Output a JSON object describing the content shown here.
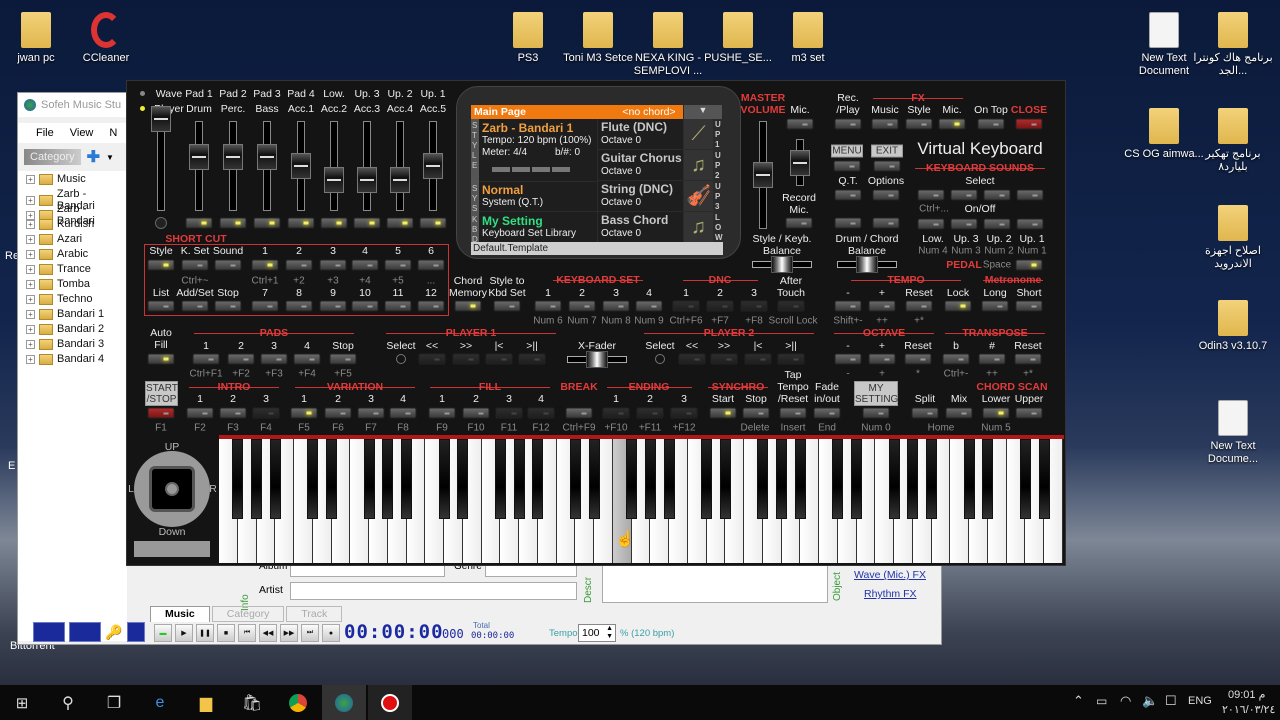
{
  "desktop": {
    "icons_left": [
      "jwan pc",
      "CCleaner"
    ],
    "icons_top": [
      "PS3",
      "Toni M3 Setce",
      "NEXA KING - SEMPLOVI ...",
      "PUSHE_SE...",
      "m3 set"
    ],
    "icons_right": [
      "New Text Document",
      "برنامج هاك كونترا الجد...",
      "CS OG aimwa...",
      "برنامج تهكير بليارد٨",
      "اصلاح اجهزة الاندرويد",
      "Odin3 v3.10.7",
      "New Text Docume..."
    ],
    "partial_left": [
      "Re",
      "E",
      "Bittorrent"
    ]
  },
  "sofeh": {
    "title": "Sofeh Music Stu",
    "menu": [
      "File",
      "View",
      "N"
    ],
    "category_tab": "Category",
    "tree": [
      "Music",
      "Zarb - Bandari",
      "Zarb - Bandari",
      "Kurdish",
      "Azari",
      "Arabic",
      "Trance",
      "Tomba",
      "Techno",
      "Bandari 1",
      "Bandari 2",
      "Bandari 3",
      "Bandari 4"
    ],
    "fields": {
      "album": "Album",
      "genre": "Genre",
      "artist": "Artist",
      "info": "Info",
      "descr": "Descr",
      "object": "Object"
    },
    "links": [
      "Wave (Mic.) FX",
      "Rhythm FX"
    ],
    "tabs": [
      "Music",
      "Category",
      "Track"
    ],
    "time": "00:00:00",
    "ms": "000",
    "total_label": "Total",
    "total": "00:00:00",
    "tempo_label": "Tempo",
    "tempo_value": "100",
    "tempo_unit": "% (120 bpm)"
  },
  "vk": {
    "mixer": {
      "top": [
        "Wave",
        "Pad 1",
        "Pad 2",
        "Pad 3",
        "Pad 4",
        "Low.",
        "Up. 3",
        "Up. 2",
        "Up. 1"
      ],
      "bottom": [
        "Player",
        "Drum",
        "Perc.",
        "Bass",
        "Acc.1",
        "Acc.2",
        "Acc.3",
        "Acc.4",
        "Acc.5"
      ],
      "levels": [
        1.0,
        0.6,
        0.6,
        0.6,
        0.5,
        0.35,
        0.35,
        0.35,
        0.5
      ],
      "leds_on": [
        false,
        true,
        true,
        true,
        true,
        true,
        true,
        true,
        true
      ]
    },
    "shortcut": {
      "title": "SHORT CUT",
      "row1": [
        "Style",
        "K. Set",
        "Sound",
        "1",
        "2",
        "3",
        "4",
        "5",
        "6"
      ],
      "row1_on": [
        true,
        false,
        false,
        true,
        false,
        false,
        false,
        false,
        false
      ],
      "hints": [
        "",
        "Ctrl+~",
        "",
        "Ctrl+1",
        "+2",
        "+3",
        "+4",
        "+5",
        "..."
      ],
      "row2": [
        "List",
        "Add/Set",
        "Stop",
        "7",
        "8",
        "9",
        "10",
        "11",
        "12"
      ]
    },
    "screen": {
      "header": "Main Page",
      "chord": "<no chord>",
      "style_name": "Zarb - Bandari 1",
      "tempo": "Tempo: 120 bpm (100%)",
      "meter": "Meter: 4/4",
      "key": "b/#:  0",
      "sys_name": "Normal",
      "sys_sub": "System (Q.T.)",
      "kbd_name": "My Setting",
      "kbd_sub": "Keyboard Set Library",
      "sounds": [
        {
          "name": "Flute (DNC)",
          "octave": "Octave 0",
          "tag": "UP1"
        },
        {
          "name": "Guitar Chorus",
          "octave": "Octave 0",
          "tag": "UP2"
        },
        {
          "name": "String (DNC)",
          "octave": "Octave 0",
          "tag": "UP3"
        },
        {
          "name": "Bass Chord",
          "octave": "Octave 0",
          "tag": "LOW"
        }
      ],
      "side": [
        "STYLE",
        "SYS",
        "KBD"
      ],
      "footer": "Default.Template"
    },
    "chord_memory": [
      "Chord",
      "Memory"
    ],
    "style_to_kbd": [
      "Style to",
      "Kbd Set"
    ],
    "keyboard_set": {
      "title": "KEYBOARD SET",
      "items": [
        "1",
        "2",
        "3",
        "4"
      ],
      "hints": [
        "Num 6",
        "Num 7",
        "Num 8",
        "Num 9"
      ]
    },
    "dnc": {
      "title": "DNC",
      "items": [
        "1",
        "2",
        "3"
      ],
      "hints": [
        "Ctrl+F6",
        "+F7",
        "+F8"
      ]
    },
    "after_touch": [
      "After",
      "Touch"
    ],
    "scroll_lock": "Scroll Lock",
    "master_volume": [
      "MASTER",
      "VOLUME"
    ],
    "master_level": 0.5,
    "mic": "Mic.",
    "mic_level": 0.5,
    "record_mic": [
      "Record",
      "Mic."
    ],
    "rec_play": [
      "Rec.",
      "/Play"
    ],
    "fx": {
      "title": "FX",
      "items": [
        "Music",
        "Style",
        "Mic."
      ]
    },
    "on_top": "On Top",
    "close": "CLOSE",
    "menu": "MENU",
    "exit": "EXIT",
    "qt": "Q.T.",
    "options": "Options",
    "title": "Virtual Keyboard",
    "keyboard_sounds": {
      "title": "KEYBOARD SOUNDS",
      "select": "Select",
      "ctrl": "Ctrl+...",
      "onoff": "On/Off",
      "items": [
        "Low.",
        "Up. 3",
        "Up. 2",
        "Up. 1"
      ],
      "hints": [
        "Num 4",
        "Num 3",
        "Num 2",
        "Num 1"
      ]
    },
    "pedal": "PEDAL",
    "space": "Space",
    "style_balance": [
      "Style / Keyb.",
      "Balance"
    ],
    "drum_balance": [
      "Drum / Chord",
      "Balance"
    ],
    "balance_levels": [
      0.5,
      0.5
    ],
    "tempo": {
      "title": "TEMPO",
      "items": [
        "-",
        "+",
        "Reset",
        "Lock"
      ],
      "hints": [
        "Shift+-",
        "++",
        "+*"
      ]
    },
    "metronome": {
      "title": "Metronome",
      "items": [
        "Long",
        "Short"
      ]
    },
    "auto_fill": [
      "Auto",
      "Fill"
    ],
    "pads": {
      "title": "PADS",
      "items": [
        "1",
        "2",
        "3",
        "4",
        "Stop"
      ],
      "hints": [
        "Ctrl+F1",
        "+F2",
        "+F3",
        "+F4",
        "+F5"
      ]
    },
    "player1": {
      "title": "PLAYER 1",
      "items": [
        "Select",
        "<<",
        ">>",
        "|<",
        ">||"
      ]
    },
    "xfader": "X-Fader",
    "xfader_level": 0.5,
    "player2": {
      "title": "PLAYER 2",
      "items": [
        "Select",
        "<<",
        ">>",
        "|<",
        ">||"
      ]
    },
    "octave": {
      "title": "OCTAVE",
      "items": [
        "-",
        "+",
        "Reset"
      ],
      "hints": [
        "-",
        "+",
        "*"
      ]
    },
    "transpose": {
      "title": "TRANSPOSE",
      "items": [
        "b",
        "#",
        "Reset"
      ],
      "hints": [
        "Ctrl+-",
        "++",
        "+*"
      ]
    },
    "start_stop": [
      "START",
      "/STOP"
    ],
    "intro": {
      "title": "INTRO",
      "items": [
        "1",
        "2",
        "3"
      ]
    },
    "variation": {
      "title": "VARIATION",
      "items": [
        "1",
        "2",
        "3",
        "4"
      ]
    },
    "fill": {
      "title": "FILL",
      "items": [
        "1",
        "2",
        "3",
        "4"
      ]
    },
    "break": "BREAK",
    "ending": {
      "title": "ENDING",
      "items": [
        "1",
        "2",
        "3"
      ]
    },
    "synchro": {
      "title": "SYNCHRO",
      "items": [
        "Start",
        "Stop"
      ]
    },
    "tap_tempo": [
      "Tap",
      "Tempo",
      "/Reset"
    ],
    "fade": [
      "Fade",
      "in/out"
    ],
    "my_setting": [
      "MY",
      "SETTING"
    ],
    "split": "Split",
    "mix": "Mix",
    "chord_scan": {
      "title": "CHORD SCAN",
      "items": [
        "Lower",
        "Upper"
      ]
    },
    "fkeys": [
      "F1",
      "F2",
      "F3",
      "F4",
      "F5",
      "F6",
      "F7",
      "F8",
      "F9",
      "F10",
      "F11",
      "F12",
      "Ctrl+F9",
      "+F10",
      "+F11",
      "+F12",
      "Delete",
      "Insert",
      "End",
      "Num 0",
      "Home",
      "Num 5"
    ],
    "joystick": {
      "up": "UP",
      "down": "Down",
      "left": "L",
      "right": "R"
    }
  },
  "taskbar": {
    "lang": "ENG",
    "time": "09:01 م",
    "date": "٢٠١٦/٠٣/٢٤"
  }
}
